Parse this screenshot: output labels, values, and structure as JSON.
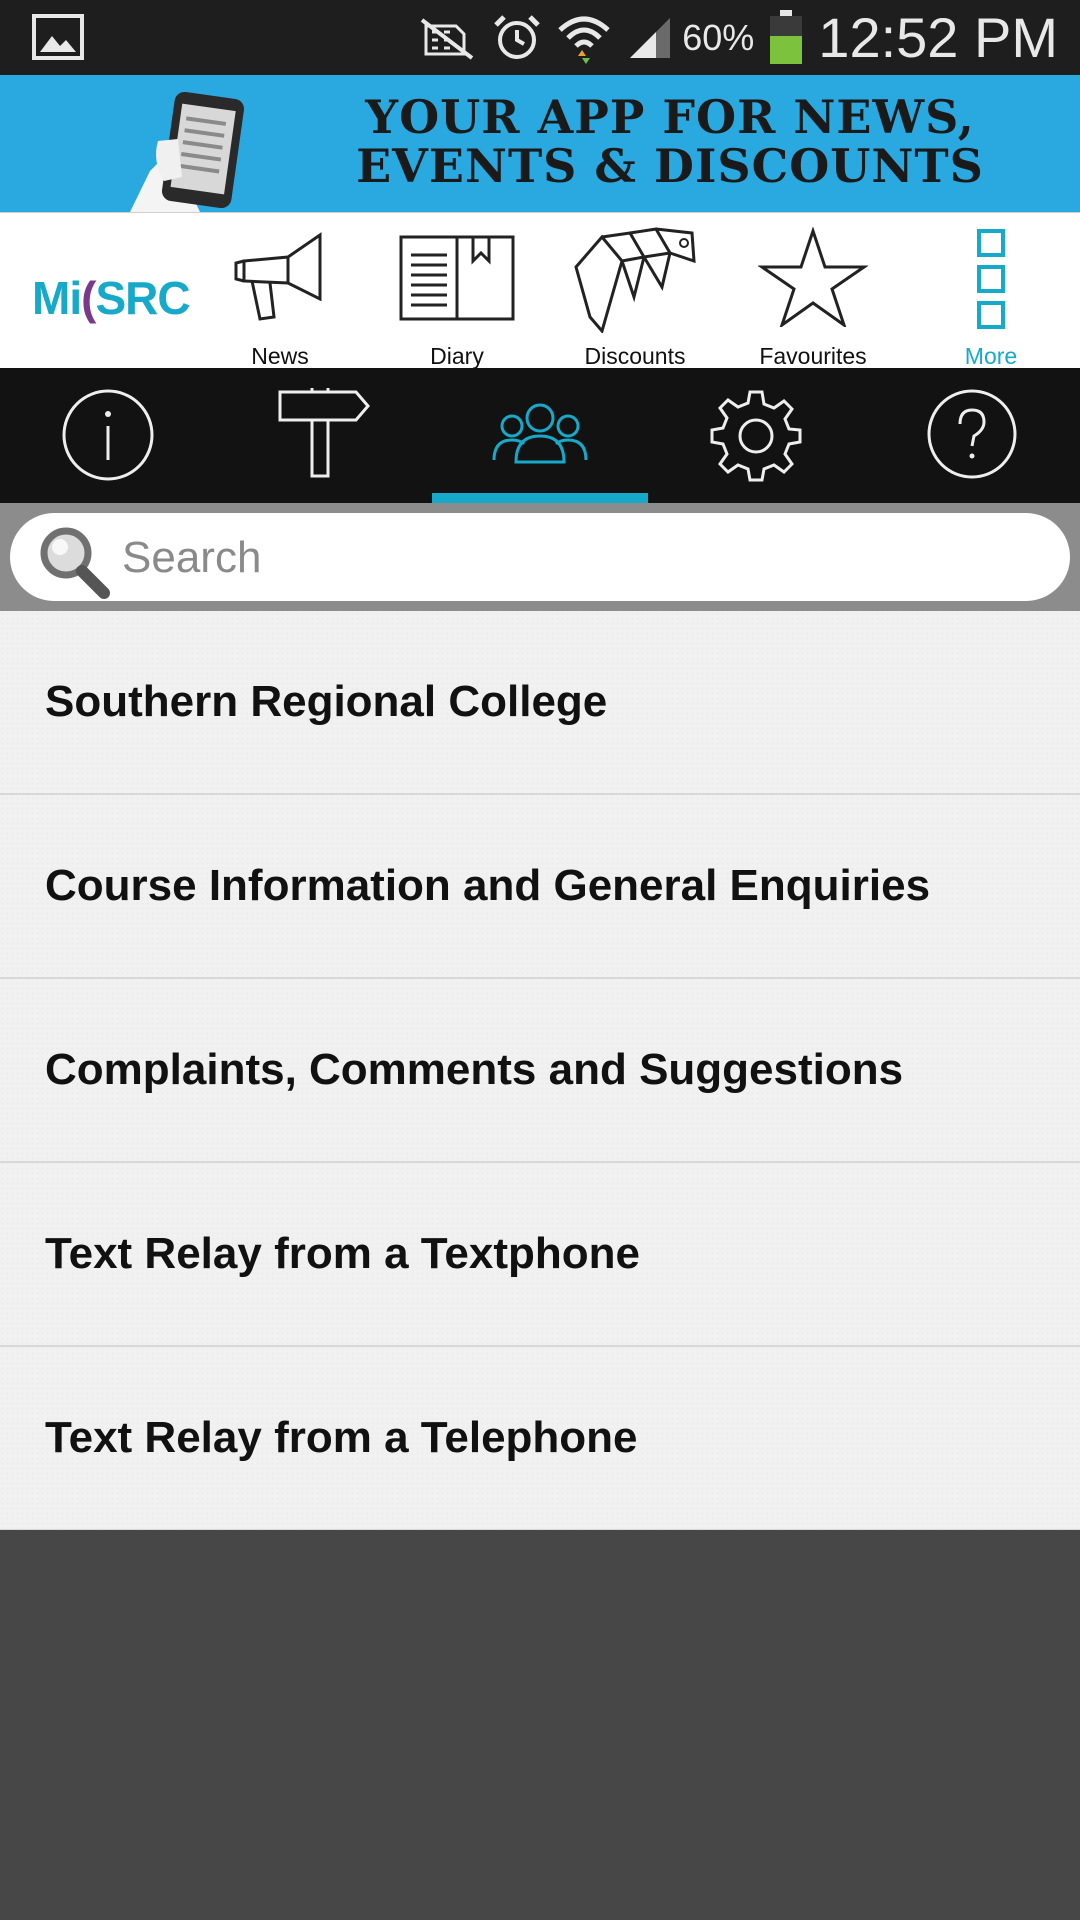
{
  "status_bar": {
    "battery_percent": "60%",
    "time": "12:52 PM",
    "icons": [
      "gallery-icon",
      "no-sim-icon",
      "alarm-icon",
      "wifi-icon",
      "signal-icon",
      "battery-icon"
    ]
  },
  "banner": {
    "line1": "YOUR APP FOR NEWS,",
    "line2": "EVENTS & DISCOUNTS"
  },
  "logo": {
    "text_a": "Mi",
    "text_b": "SRC"
  },
  "topnav": {
    "items": [
      {
        "label": "News",
        "icon": "megaphone-icon"
      },
      {
        "label": "Diary",
        "icon": "diary-book-icon"
      },
      {
        "label": "Discounts",
        "icon": "discount-tags-icon"
      },
      {
        "label": "Favourites",
        "icon": "star-icon"
      },
      {
        "label": "More",
        "icon": "more-squares-icon",
        "active": true
      }
    ]
  },
  "toolbar": {
    "items": [
      {
        "icon": "info-icon"
      },
      {
        "icon": "signpost-icon"
      },
      {
        "icon": "people-icon",
        "active": true
      },
      {
        "icon": "gear-icon"
      },
      {
        "icon": "help-icon"
      }
    ]
  },
  "search": {
    "placeholder": "Search",
    "value": ""
  },
  "contacts": {
    "items": [
      "Southern Regional College",
      "Course Information and General Enquiries",
      "Complaints, Comments and Suggestions",
      "Text Relay from a Textphone",
      "Text Relay from a Telephone"
    ]
  },
  "colors": {
    "accent": "#17a9c9",
    "banner": "#2aa8e0",
    "toolbar": "#121212"
  }
}
